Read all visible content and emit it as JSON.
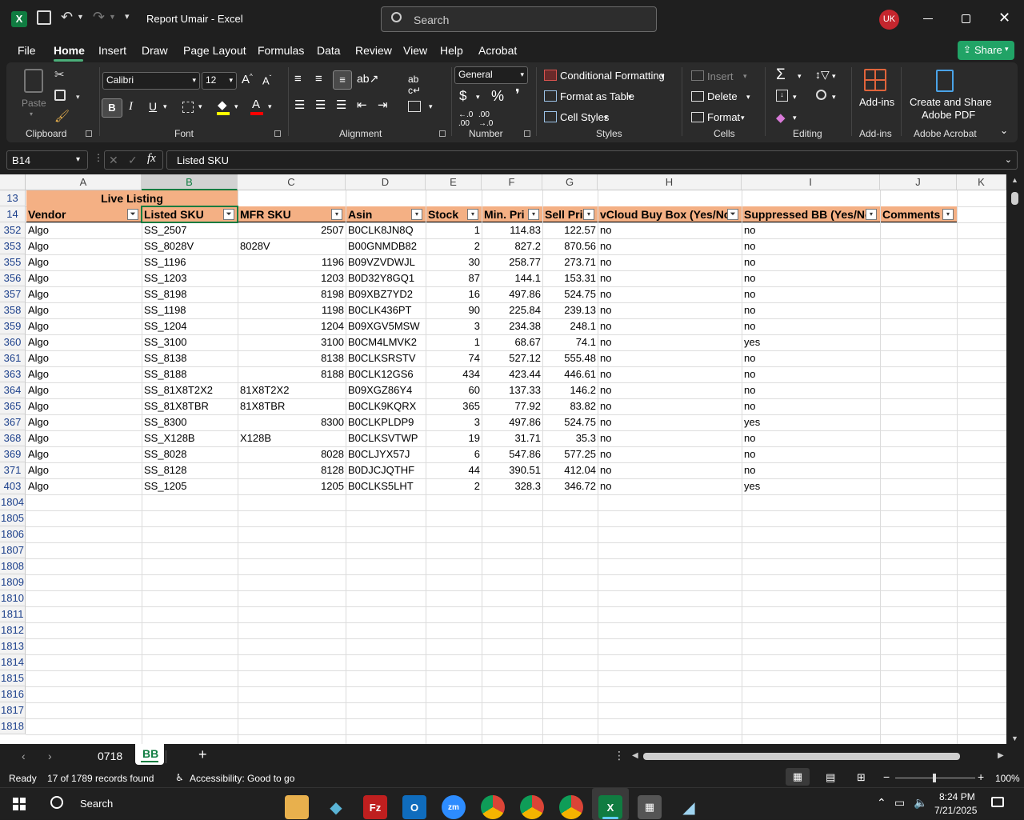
{
  "title_bar": {
    "doc_title": "Report Umair  -  Excel",
    "search_placeholder": "Search",
    "user_initials": "UK"
  },
  "menu": {
    "items": [
      "File",
      "Home",
      "Insert",
      "Draw",
      "Page Layout",
      "Formulas",
      "Data",
      "Review",
      "View",
      "Help",
      "Acrobat"
    ],
    "active": "Home",
    "share": "Share"
  },
  "ribbon": {
    "clipboard": {
      "paste": "Paste",
      "label": "Clipboard"
    },
    "font": {
      "family": "Calibri",
      "size": "12",
      "label": "Font"
    },
    "alignment": {
      "label": "Alignment"
    },
    "number": {
      "format": "General",
      "label": "Number"
    },
    "styles": {
      "conditional": "Conditional Formatting",
      "format_table": "Format as Table",
      "cell_styles": "Cell Styles",
      "label": "Styles"
    },
    "cells": {
      "insert": "Insert",
      "delete": "Delete",
      "format": "Format",
      "label": "Cells"
    },
    "editing": {
      "label": "Editing"
    },
    "addins": {
      "button": "Add-ins",
      "label": "Add-ins"
    },
    "acrobat": {
      "button_line1": "Create and Share",
      "button_line2": "Adobe PDF",
      "label": "Adobe Acrobat"
    }
  },
  "formula_bar": {
    "name_box": "B14",
    "fx": "fx",
    "content": "Listed SKU"
  },
  "columns": [
    "A",
    "B",
    "C",
    "D",
    "E",
    "F",
    "G",
    "H",
    "I",
    "J",
    "K"
  ],
  "sheet": {
    "title_row": {
      "row": "13",
      "text": "Live Listing"
    },
    "header_row": {
      "row": "14",
      "headers": [
        "Vendor",
        "Listed SKU",
        "MFR SKU",
        "Asin",
        "Stock",
        "Min. Pri",
        "Sell Pri",
        "vCloud Buy Box (Yes/No",
        "Suppressed BB (Yes/No",
        "Comments"
      ]
    },
    "rows": [
      {
        "r": "352",
        "c": [
          "Algo",
          "SS_2507",
          "2507",
          "B0CLK8JN8Q",
          "1",
          "114.83",
          "122.57",
          "no",
          "no",
          ""
        ]
      },
      {
        "r": "353",
        "c": [
          "Algo",
          "SS_8028V",
          "8028V",
          "B00GNMDB82",
          "2",
          "827.2",
          "870.56",
          "no",
          "no",
          ""
        ]
      },
      {
        "r": "355",
        "c": [
          "Algo",
          "SS_1196",
          "1196",
          "B09VZVDWJL",
          "30",
          "258.77",
          "273.71",
          "no",
          "no",
          ""
        ]
      },
      {
        "r": "356",
        "c": [
          "Algo",
          "SS_1203",
          "1203",
          "B0D32Y8GQ1",
          "87",
          "144.1",
          "153.31",
          "no",
          "no",
          ""
        ]
      },
      {
        "r": "357",
        "c": [
          "Algo",
          "SS_8198",
          "8198",
          "B09XBZ7YD2",
          "16",
          "497.86",
          "524.75",
          "no",
          "no",
          ""
        ]
      },
      {
        "r": "358",
        "c": [
          "Algo",
          "SS_1198",
          "1198",
          "B0CLK436PT",
          "90",
          "225.84",
          "239.13",
          "no",
          "no",
          ""
        ]
      },
      {
        "r": "359",
        "c": [
          "Algo",
          "SS_1204",
          "1204",
          "B09XGV5MSW",
          "3",
          "234.38",
          "248.1",
          "no",
          "no",
          ""
        ]
      },
      {
        "r": "360",
        "c": [
          "Algo",
          "SS_3100",
          "3100",
          "B0CM4LMVK2",
          "1",
          "68.67",
          "74.1",
          "no",
          "yes",
          ""
        ]
      },
      {
        "r": "361",
        "c": [
          "Algo",
          "SS_8138",
          "8138",
          "B0CLKSRSTV",
          "74",
          "527.12",
          "555.48",
          "no",
          "no",
          ""
        ]
      },
      {
        "r": "363",
        "c": [
          "Algo",
          "SS_8188",
          "8188",
          "B0CLK12GS6",
          "434",
          "423.44",
          "446.61",
          "no",
          "no",
          ""
        ]
      },
      {
        "r": "364",
        "c": [
          "Algo",
          "SS_81X8T2X2",
          "81X8T2X2",
          "B09XGZ86Y4",
          "60",
          "137.33",
          "146.2",
          "no",
          "no",
          ""
        ]
      },
      {
        "r": "365",
        "c": [
          "Algo",
          "SS_81X8TBR",
          "81X8TBR",
          "B0CLK9KQRX",
          "365",
          "77.92",
          "83.82",
          "no",
          "no",
          ""
        ]
      },
      {
        "r": "367",
        "c": [
          "Algo",
          "SS_8300",
          "8300",
          "B0CLKPLDP9",
          "3",
          "497.86",
          "524.75",
          "no",
          "yes",
          ""
        ]
      },
      {
        "r": "368",
        "c": [
          "Algo",
          "SS_X128B",
          "X128B",
          "B0CLKSVTWP",
          "19",
          "31.71",
          "35.3",
          "no",
          "no",
          ""
        ]
      },
      {
        "r": "369",
        "c": [
          "Algo",
          "SS_8028",
          "8028",
          "B0CLJYX57J",
          "6",
          "547.86",
          "577.25",
          "no",
          "no",
          ""
        ]
      },
      {
        "r": "371",
        "c": [
          "Algo",
          "SS_8128",
          "8128",
          "B0DJCJQTHF",
          "44",
          "390.51",
          "412.04",
          "no",
          "no",
          ""
        ]
      },
      {
        "r": "403",
        "c": [
          "Algo",
          "SS_1205",
          "1205",
          "B0CLKS5LHT",
          "2",
          "328.3",
          "346.72",
          "no",
          "yes",
          ""
        ]
      }
    ],
    "empty_rows": [
      "1804",
      "1805",
      "1806",
      "1807",
      "1808",
      "1809",
      "1810",
      "1811",
      "1812",
      "1813",
      "1814",
      "1815",
      "1816",
      "1817",
      "1818"
    ]
  },
  "sheet_tabs": [
    {
      "label": "0718",
      "active": false
    },
    {
      "label": "BB",
      "active": true
    }
  ],
  "status": {
    "mode": "Ready",
    "records": "17 of 1789 records found",
    "accessibility": "Accessibility: Good to go",
    "zoom": "100%"
  },
  "taskbar": {
    "search": "Search",
    "time": "8:24 PM",
    "date": "7/21/2025"
  },
  "colors": {
    "header_fill": "#f4b084",
    "excel_green": "#107c41",
    "accent_green": "#21a366"
  }
}
